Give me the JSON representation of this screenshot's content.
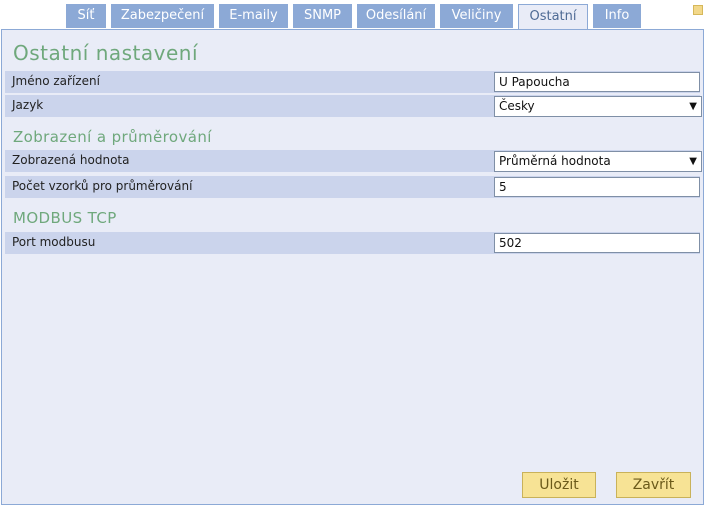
{
  "tabs": [
    {
      "label": "Síť",
      "active": false
    },
    {
      "label": "Zabezpečení",
      "active": false
    },
    {
      "label": "E-maily",
      "active": false
    },
    {
      "label": "SNMP",
      "active": false
    },
    {
      "label": "Odesílání",
      "active": false
    },
    {
      "label": "Veličiny",
      "active": false
    },
    {
      "label": "Ostatní",
      "active": true
    },
    {
      "label": "Info",
      "active": false
    }
  ],
  "page": {
    "title": "Ostatní nastavení"
  },
  "general": {
    "device_name_label": "Jméno zařízení",
    "device_name_value": "U Papoucha",
    "language_label": "Jazyk",
    "language_value": "Česky"
  },
  "display": {
    "section_title": "Zobrazení a průměrování",
    "shown_value_label": "Zobrazená hodnota",
    "shown_value_value": "Průměrná hodnota",
    "samples_label": "Počet vzorků pro průměrování",
    "samples_value": "5"
  },
  "modbus": {
    "section_title": "MODBUS TCP",
    "port_label": "Port modbusu",
    "port_value": "502"
  },
  "buttons": {
    "save_label": "Uložit",
    "close_label": "Zavřít"
  },
  "icons": {
    "dropdown_arrow": "▼"
  },
  "colors": {
    "tab_bg": "#8ca9d6",
    "panel_bg": "#e9ecf7",
    "row_bg": "#cbd4ec",
    "heading": "#6fa87c",
    "button_bg": "#f7e395"
  }
}
